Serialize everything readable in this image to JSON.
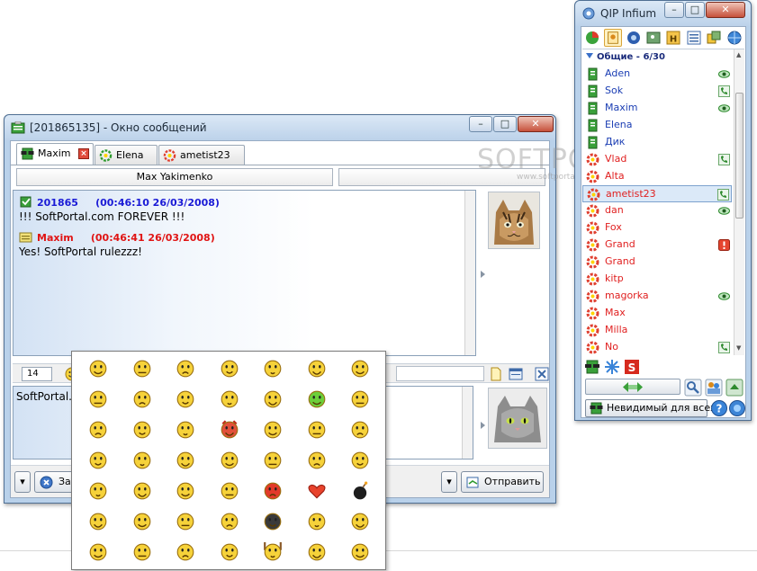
{
  "message_window": {
    "title": "[201865135] - Окно сообщений",
    "tabs": [
      {
        "label": "Maxim",
        "active": true
      },
      {
        "label": "Elena",
        "active": false
      },
      {
        "label": "ametist23",
        "active": false
      }
    ],
    "contact_name": "Max Yakimenko",
    "messages": [
      {
        "sender": "201865",
        "time": "(00:46:10 26/03/2008)",
        "text": "!!! SoftPortal.com FOREVER !!!",
        "color": "#1a1ad6"
      },
      {
        "sender": "Maxim",
        "time": "(00:46:41 26/03/2008)",
        "text": "Yes! SoftPortal rulezzz!",
        "color": "#e01414"
      }
    ],
    "char_counter": "14",
    "input_text": "SoftPortal.",
    "close_button_label": "За",
    "send_button_label": "Отправить"
  },
  "watermark": {
    "main": "SOFTPORTAL",
    "sub": "www.softportal.com"
  },
  "qip": {
    "title": "QIP Infium",
    "group_label": "Общие - 6/30",
    "contacts": [
      {
        "name": "Aden",
        "online": true,
        "status": "eye"
      },
      {
        "name": "Sok",
        "online": true,
        "status": "phone"
      },
      {
        "name": "Maxim",
        "online": true,
        "status": "eye"
      },
      {
        "name": "Elena",
        "online": true,
        "status": ""
      },
      {
        "name": "Дик",
        "online": true,
        "status": ""
      },
      {
        "name": "Vlad",
        "online": false,
        "status": "phone"
      },
      {
        "name": "Alta",
        "online": false,
        "status": ""
      },
      {
        "name": "ametist23",
        "online": false,
        "status": "phone",
        "selected": true
      },
      {
        "name": "dan",
        "online": false,
        "status": "eye"
      },
      {
        "name": "Fox",
        "online": false,
        "status": ""
      },
      {
        "name": "Grand",
        "online": false,
        "status": "alert"
      },
      {
        "name": "Grand",
        "online": false,
        "status": ""
      },
      {
        "name": "kitp",
        "online": false,
        "status": ""
      },
      {
        "name": "magorka",
        "online": false,
        "status": "eye"
      },
      {
        "name": "Max",
        "online": false,
        "status": ""
      },
      {
        "name": "Milla",
        "online": false,
        "status": ""
      },
      {
        "name": "No",
        "online": false,
        "status": "phone"
      }
    ],
    "status_label": "Невидимый для всех"
  },
  "colors": {
    "online_contact": "#1a3db3",
    "offline_contact": "#e02020",
    "window_frame": "#b9d1ea"
  },
  "smiles": {
    "count": 49
  }
}
